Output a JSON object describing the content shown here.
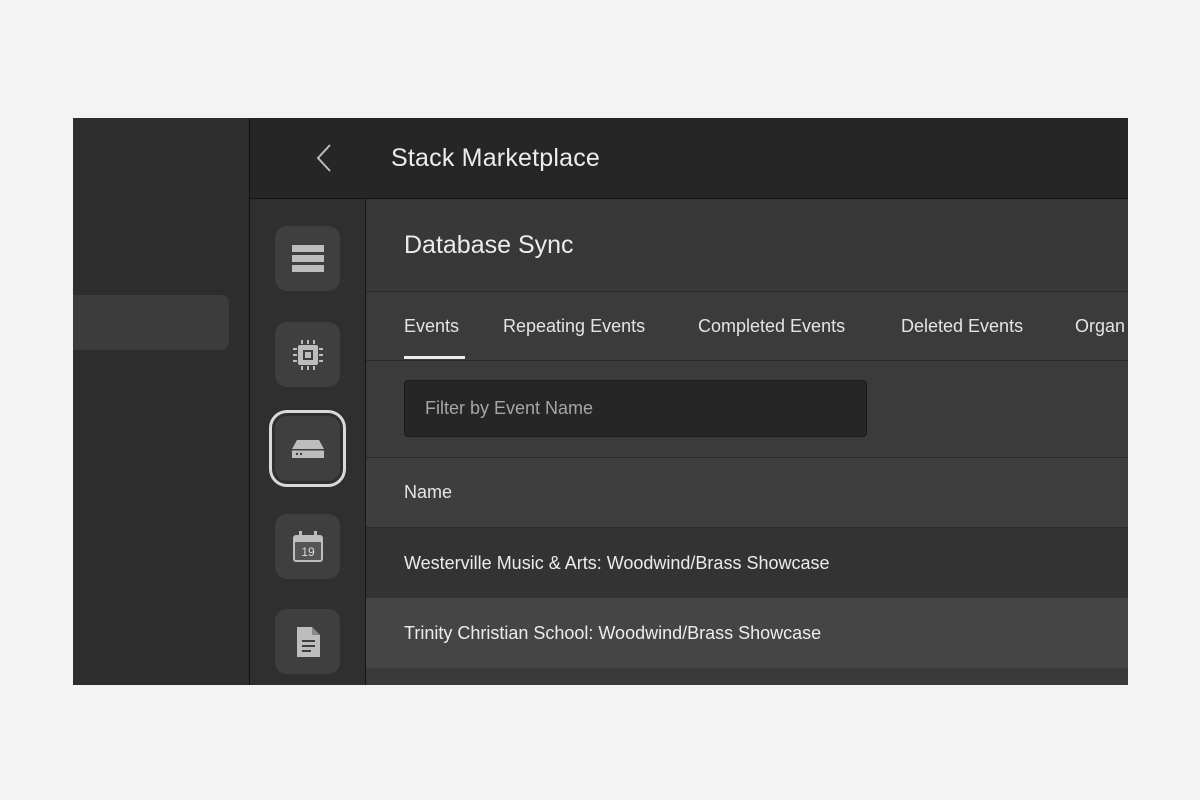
{
  "header": {
    "title": "Stack Marketplace"
  },
  "rail": [
    {
      "icon": "stack-icon",
      "active": false
    },
    {
      "icon": "chip-icon",
      "active": false
    },
    {
      "icon": "drive-icon",
      "active": true
    },
    {
      "icon": "calendar-icon",
      "active": false,
      "text": "19"
    },
    {
      "icon": "document-icon",
      "active": false
    }
  ],
  "main": {
    "title": "Database Sync",
    "tabs": [
      {
        "label": "Events",
        "active": true
      },
      {
        "label": "Repeating Events"
      },
      {
        "label": "Completed Events"
      },
      {
        "label": "Deleted Events"
      },
      {
        "label": "Organ"
      }
    ],
    "filter": {
      "placeholder": "Filter by Event Name",
      "value": ""
    },
    "table": {
      "columns": [
        "Name"
      ],
      "rows": [
        "Westerville Music & Arts: Woodwind/Brass Showcase",
        "Trinity Christian School: Woodwind/Brass Showcase"
      ]
    }
  },
  "colors": {
    "accent": "#ededed",
    "background": "#2a2a2a"
  }
}
